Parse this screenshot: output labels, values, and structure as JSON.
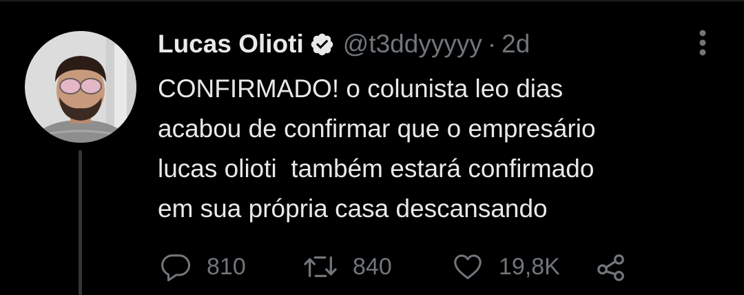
{
  "tweet": {
    "display_name": "Lucas Olioti",
    "handle": "@t3ddyyyyy",
    "separator": "·",
    "timestamp": "2d",
    "body_lines": [
      "CONFIRMADO! o colunista leo dias",
      "acabou de confirmar que o empresário",
      "lucas olioti  também estará confirmado",
      "em sua própria casa descansando"
    ]
  },
  "actions": {
    "replies": "810",
    "retweets": "840",
    "likes": "19,8K"
  },
  "icons": {
    "verified": "verified-badge-icon",
    "more": "more-options-icon",
    "reply": "reply-icon",
    "retweet": "retweet-icon",
    "like": "heart-icon",
    "share": "share-icon"
  },
  "colors": {
    "background": "#000000",
    "text_primary": "#e7e9ea",
    "text_secondary": "#71767b",
    "thread_line": "#333639"
  }
}
